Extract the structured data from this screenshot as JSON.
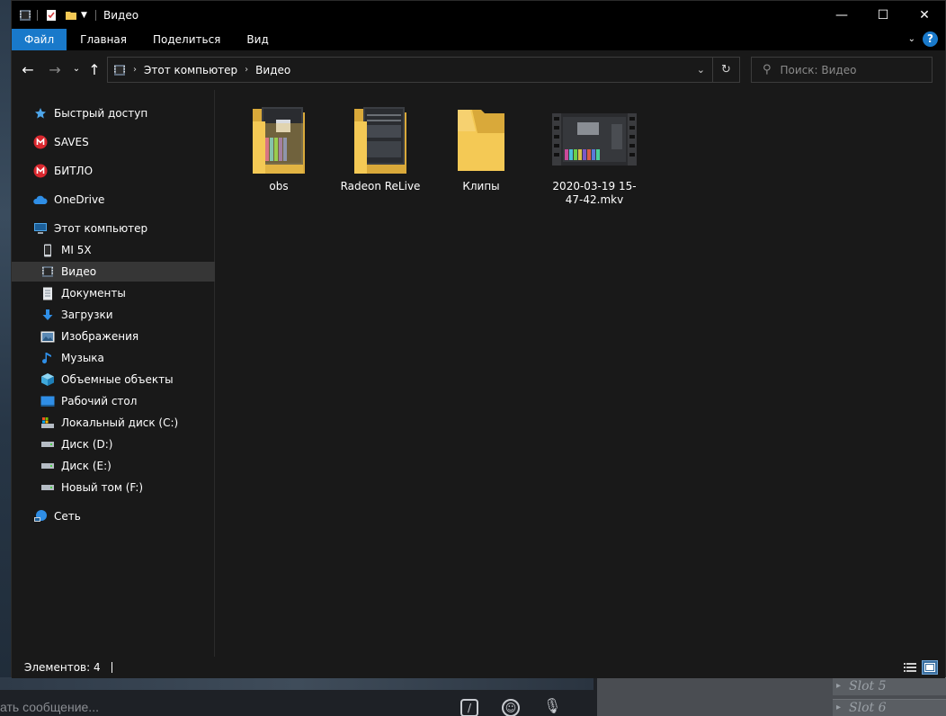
{
  "window": {
    "title": "Видео",
    "controls": {
      "minimize": "—",
      "maximize": "☐",
      "close": "✕"
    }
  },
  "ribbon": {
    "tabs": [
      {
        "label": "Файл",
        "active": true
      },
      {
        "label": "Главная",
        "active": false
      },
      {
        "label": "Поделиться",
        "active": false
      },
      {
        "label": "Вид",
        "active": false
      }
    ],
    "help": "?"
  },
  "address": {
    "crumbs": [
      "Этот компьютер",
      "Видео"
    ]
  },
  "search": {
    "placeholder": "Поиск: Видео"
  },
  "sidebar": {
    "items": [
      {
        "label": "Быстрый доступ",
        "icon": "star-icon",
        "indent": 1
      },
      {
        "label": "SAVES",
        "icon": "mega-icon",
        "indent": 1
      },
      {
        "label": "БИТЛО",
        "icon": "mega-icon",
        "indent": 1
      },
      {
        "label": "OneDrive",
        "icon": "cloud-icon",
        "indent": 1
      },
      {
        "label": "Этот компьютер",
        "icon": "computer-icon",
        "indent": 1
      },
      {
        "label": "MI 5X",
        "icon": "phone-icon",
        "indent": 2
      },
      {
        "label": "Видео",
        "icon": "video-icon",
        "indent": 2,
        "selected": true
      },
      {
        "label": "Документы",
        "icon": "document-icon",
        "indent": 2
      },
      {
        "label": "Загрузки",
        "icon": "download-icon",
        "indent": 2
      },
      {
        "label": "Изображения",
        "icon": "picture-icon",
        "indent": 2
      },
      {
        "label": "Музыка",
        "icon": "music-icon",
        "indent": 2
      },
      {
        "label": "Объемные объекты",
        "icon": "cube-icon",
        "indent": 2
      },
      {
        "label": "Рабочий стол",
        "icon": "desktop-icon",
        "indent": 2
      },
      {
        "label": "Локальный диск (C:)",
        "icon": "system-drive-icon",
        "indent": 2
      },
      {
        "label": "Диск (D:)",
        "icon": "drive-icon",
        "indent": 2
      },
      {
        "label": "Диск (E:)",
        "icon": "drive-icon",
        "indent": 2
      },
      {
        "label": "Новый том (F:)",
        "icon": "drive-icon",
        "indent": 2
      },
      {
        "label": "Сеть",
        "icon": "network-icon",
        "indent": 1
      }
    ]
  },
  "files": [
    {
      "label": "obs",
      "type": "folder-with-preview"
    },
    {
      "label": "Radeon ReLive",
      "type": "folder-with-preview"
    },
    {
      "label": "Клипы",
      "type": "folder"
    },
    {
      "label": "2020-03-19 15-47-42.mkv",
      "type": "video"
    }
  ],
  "status": {
    "count": "Элементов: 4"
  },
  "background": {
    "message_placeholder": "ать сообщение...",
    "slots": [
      "Slot 5",
      "Slot 6"
    ]
  },
  "colors": {
    "accent": "#1979ca",
    "window_bg": "#191919",
    "titlebar_bg": "#000000",
    "selected_bg": "#363636",
    "folder_yellow": "#f4c955"
  }
}
